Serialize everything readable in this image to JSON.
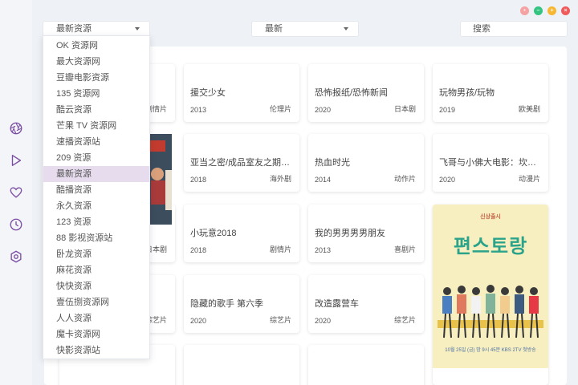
{
  "source_select": {
    "value": "最新资源",
    "options": [
      "OK 资源网",
      "最大资源网",
      "豆瓣电影资源",
      "135 资源网",
      "酷云资源",
      "芒果 TV 资源网",
      "速播资源站",
      "209 资源",
      "最新资源",
      "酷播资源",
      "永久资源",
      "123 资源",
      "88 影视资源站",
      "卧龙资源",
      "麻花资源",
      "快快资源",
      "壹伍捌资源网",
      "人人资源",
      "魔卡资源网",
      "快影资源站"
    ],
    "selected_index": 8
  },
  "category_select": {
    "value": "最新"
  },
  "search": {
    "placeholder": "搜索"
  },
  "sidebar": {
    "items": [
      {
        "icon": "aperture-icon",
        "active": true
      },
      {
        "icon": "play-icon"
      },
      {
        "icon": "heart-icon"
      },
      {
        "icon": "clock-icon"
      },
      {
        "icon": "settings-icon"
      }
    ],
    "accent": "#7b4ea3"
  },
  "window_controls": {
    "colors": [
      "#f5a2a2",
      "#33c481",
      "#f7b731",
      "#f05a5a"
    ]
  },
  "partial_tags": [
    "剧情片",
    "日本剧",
    "综艺片"
  ],
  "cards": [
    {
      "title": "援交少女",
      "year": "2013",
      "genre": "伦理片"
    },
    {
      "title": "恐怖报纸/恐怖新闻",
      "year": "2020",
      "genre": "日本剧"
    },
    {
      "title": "玩物男孩/玩物",
      "year": "2019",
      "genre": "欧美剧"
    },
    {
      "title": "亚当之密/成品室友之期…",
      "year": "2018",
      "genre": "海外剧"
    },
    {
      "title": "热血时光",
      "year": "2014",
      "genre": "动作片"
    },
    {
      "title": "飞哥与小佛大电影：坎迪…",
      "year": "2020",
      "genre": "动漫片"
    },
    {
      "title": "小玩意2018",
      "year": "2018",
      "genre": "剧情片"
    },
    {
      "title": "我的男男男男朋友",
      "year": "2013",
      "genre": "喜剧片"
    },
    {
      "title": "隐藏的歌手 第六季",
      "year": "2020",
      "genre": "综艺片"
    },
    {
      "title": "改造露营车",
      "year": "2020",
      "genre": "综艺片"
    }
  ],
  "poster": {
    "logo": "편스토랑",
    "subtitle": "신상출시",
    "date_text": "10월 25일 (금) 밤 9시 45분 KBS 2TV 첫방송"
  }
}
